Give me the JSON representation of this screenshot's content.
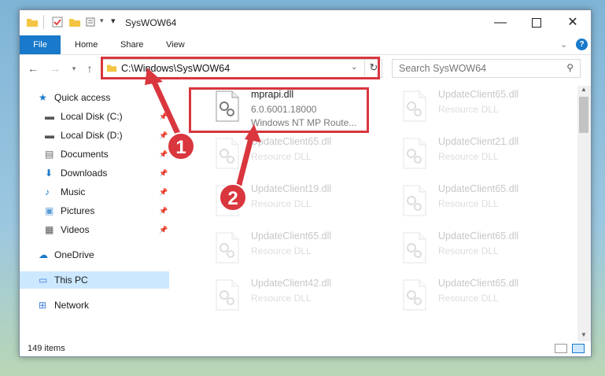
{
  "window": {
    "title": "SysWOW64",
    "minimize_icon": "minimize-icon",
    "maximize_icon": "maximize-icon",
    "close_icon": "close-icon"
  },
  "ribbon": {
    "file": "File",
    "tabs": [
      "Home",
      "Share",
      "View"
    ]
  },
  "address": {
    "path": "C:\\Windows\\SysWOW64",
    "search_placeholder": "Search SysWOW64"
  },
  "sidebar": {
    "items": [
      {
        "label": "Quick access",
        "icon": "star-icon",
        "pinned": false
      },
      {
        "label": "Local Disk (C:)",
        "icon": "drive-icon",
        "pinned": true
      },
      {
        "label": "Local Disk (D:)",
        "icon": "drive-icon",
        "pinned": true
      },
      {
        "label": "Documents",
        "icon": "documents-icon",
        "pinned": true
      },
      {
        "label": "Downloads",
        "icon": "download-icon",
        "pinned": true
      },
      {
        "label": "Music",
        "icon": "music-icon",
        "pinned": true
      },
      {
        "label": "Pictures",
        "icon": "pictures-icon",
        "pinned": true
      },
      {
        "label": "Videos",
        "icon": "videos-icon",
        "pinned": true
      },
      {
        "label": "OneDrive",
        "icon": "cloud-icon",
        "pinned": false
      },
      {
        "label": "This PC",
        "icon": "computer-icon",
        "pinned": false,
        "selected": true
      },
      {
        "label": "Network",
        "icon": "network-icon",
        "pinned": false
      }
    ]
  },
  "files": [
    {
      "name": "mprapi.dll",
      "line2": "6.0.6001.18000",
      "line3": "Windows NT MP Route...",
      "highlighted": true
    },
    {
      "name": "UpdateClient65.dll",
      "line2": "Resource DLL"
    },
    {
      "name": "UpdateClient65.dll",
      "line2": "Resource DLL"
    },
    {
      "name": "UpdateClient21.dll",
      "line2": "Resource DLL"
    },
    {
      "name": "UpdateClient19.dll",
      "line2": "Resource DLL"
    },
    {
      "name": "UpdateClient65.dll",
      "line2": "Resource DLL"
    },
    {
      "name": "UpdateClient65.dll",
      "line2": "Resource DLL"
    },
    {
      "name": "UpdateClient65.dll",
      "line2": "Resource DLL"
    },
    {
      "name": "UpdateClient42.dll",
      "line2": "Resource DLL"
    },
    {
      "name": "UpdateClient65.dll",
      "line2": "Resource DLL"
    }
  ],
  "status": {
    "item_count": "149 items"
  },
  "annotations": {
    "step1": "1",
    "step2": "2",
    "color": "#d9363e"
  }
}
